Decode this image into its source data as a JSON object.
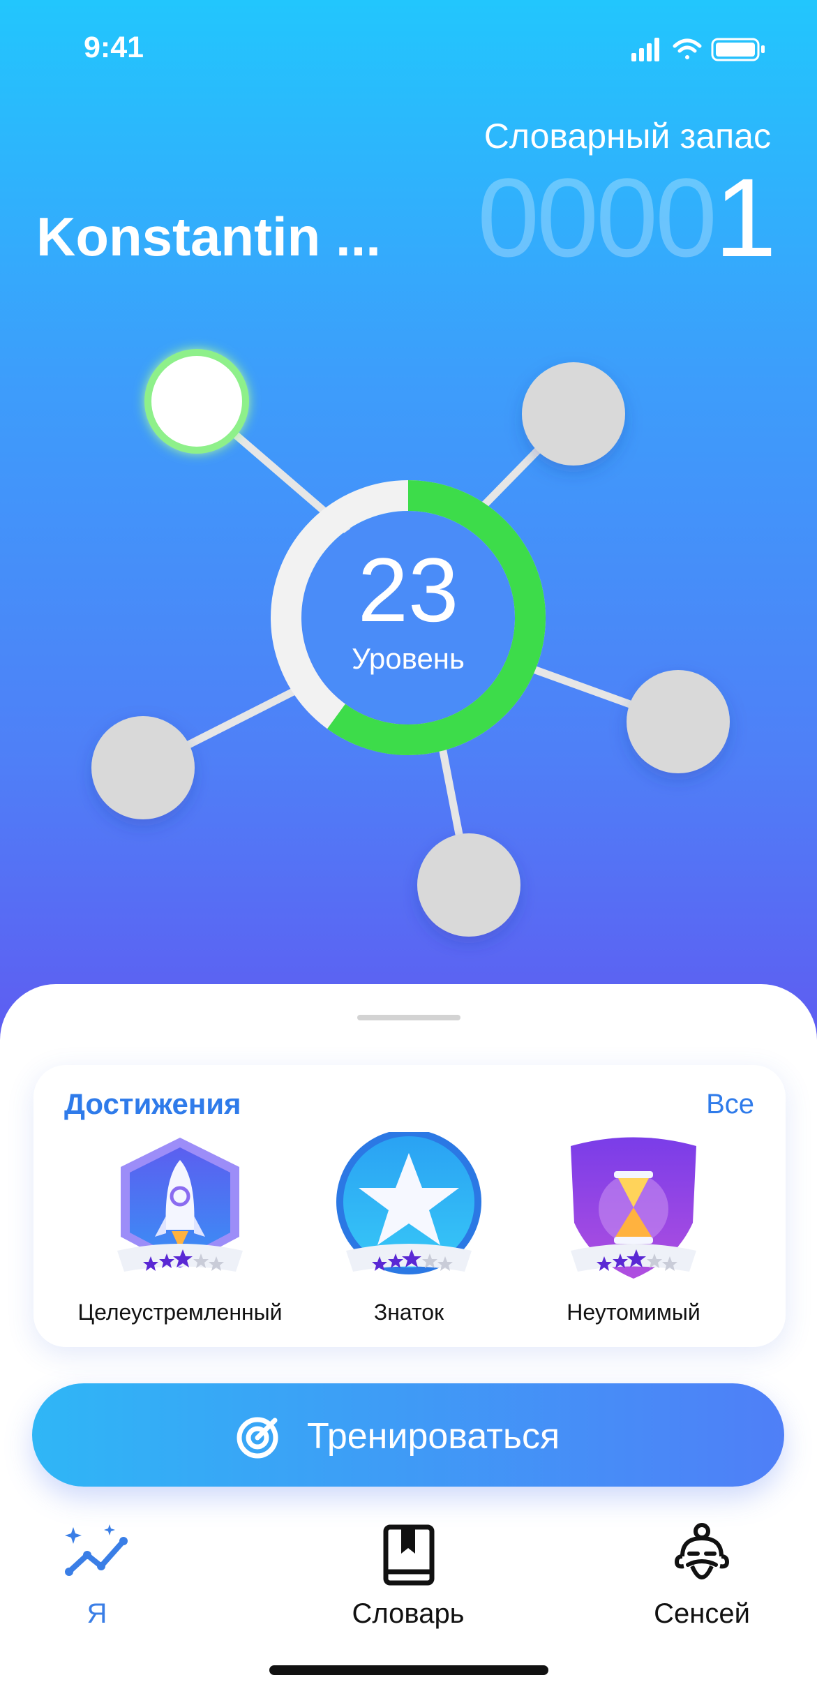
{
  "status_bar": {
    "time": "9:41"
  },
  "profile": {
    "username": "Konstantin ...",
    "vocab_label": "Словарный запас",
    "vocab_count_dim": "0000",
    "vocab_count_value": "1"
  },
  "level": {
    "number": "23",
    "label": "Уровень",
    "progress_percent": 60
  },
  "achievements": {
    "title": "Достижения",
    "all_link": "Все",
    "items": [
      {
        "name": "Целеустремленный",
        "icon": "rocket-badge-icon",
        "stars": 3
      },
      {
        "name": "Знаток",
        "icon": "star-badge-icon",
        "stars": 3
      },
      {
        "name": "Неутомимый",
        "icon": "hourglass-badge-icon",
        "stars": 3
      }
    ]
  },
  "train_button": {
    "label": "Тренироваться",
    "icon": "target-icon"
  },
  "tabs": [
    {
      "label": "Я",
      "icon": "stats-sparkle-icon",
      "active": true
    },
    {
      "label": "Словарь",
      "icon": "book-icon",
      "active": false
    },
    {
      "label": "Сенсей",
      "icon": "sensei-icon",
      "active": false
    }
  ],
  "colors": {
    "accent": "#2f7bea",
    "progress": "#3ddc4a",
    "node_inactive": "#d9d9d9",
    "node_active_ring": "#8ef08a"
  }
}
